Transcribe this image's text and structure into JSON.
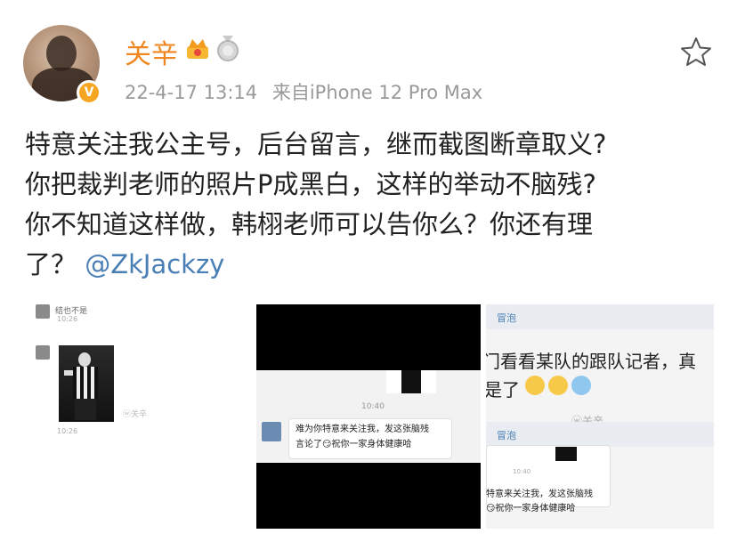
{
  "post": {
    "username": "关辛",
    "date": "22-4-17 13:14",
    "source": "来自iPhone 12 Pro Max",
    "verified_badge": "V",
    "text_lines": [
      "特意关注我公主号，后台留言，继而截图断章取义?",
      "你把裁判老师的照片P成黑白，这样的举动不脑残?",
      "你不知道这样做，韩栩老师可以告你么？你还有理"
    ],
    "last_line_prefix": "了？",
    "mention": "@ZkJackzy"
  },
  "image1": {
    "top_text": "结也不是",
    "ts1": "10:26",
    "ts2": "10:26",
    "watermark": "ⓦ关辛"
  },
  "image2": {
    "timestamp": "10:40",
    "bubble_line1": "难为你特意来关注我，发这张脑残",
    "bubble_line2": "言论了😏祝你一家身体健康哈"
  },
  "image3": {
    "bar1_label": "冒泡",
    "bar2_label": "冒泡",
    "line1": "门看看某队的跟队记者，真",
    "line2": "是了",
    "watermark": "ⓦ关辛",
    "inner_line1": "特意来关注我，发这张脑残",
    "inner_line2": "😏祝你一家身体健康哈",
    "inner_small": "10:40"
  },
  "colors": {
    "username": "#f0861f",
    "mention": "#4a7fb5",
    "meta": "#9a9a9a",
    "verified": "#f6a623"
  }
}
